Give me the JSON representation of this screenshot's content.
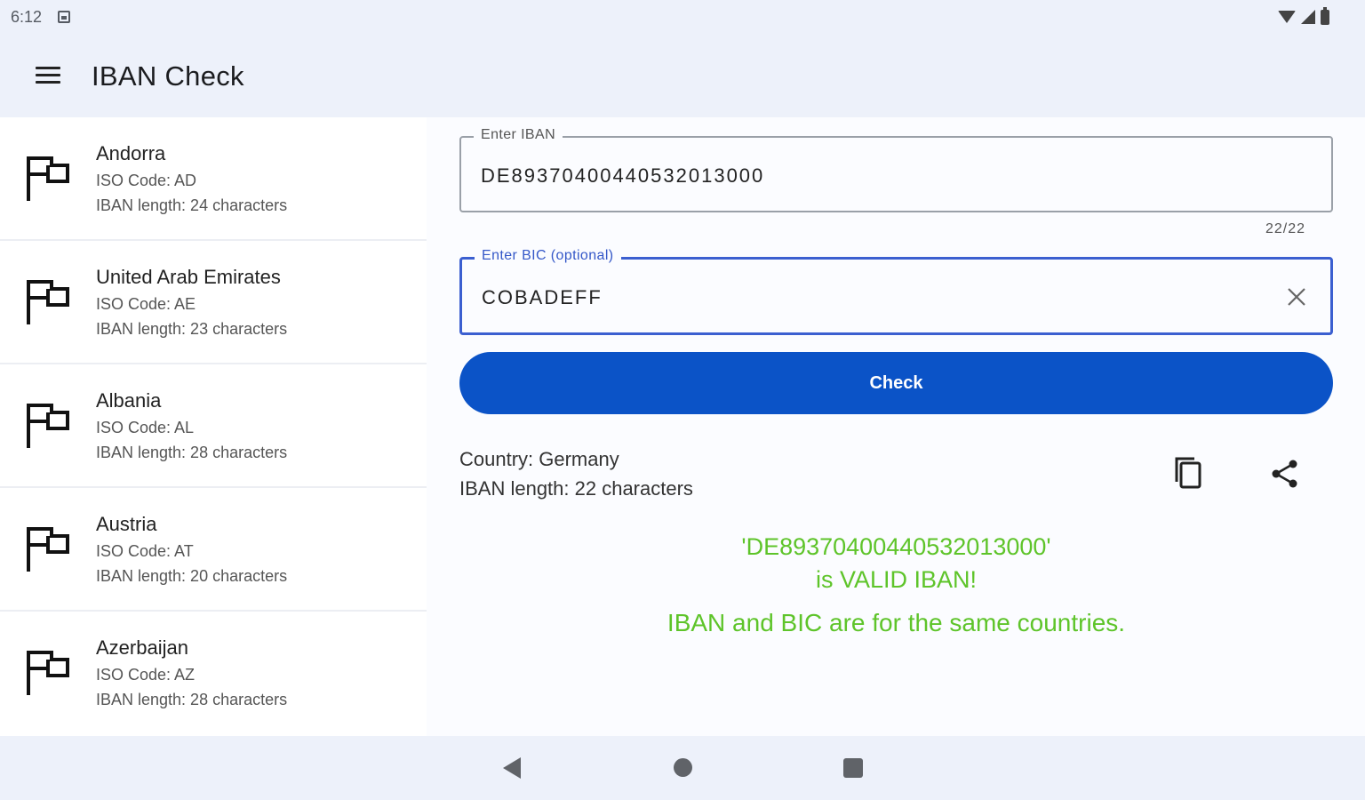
{
  "status_bar": {
    "time": "6:12"
  },
  "app_bar": {
    "title": "IBAN Check"
  },
  "countries": [
    {
      "name": "Andorra",
      "iso": "ISO Code: AD",
      "length": "IBAN length: 24 characters"
    },
    {
      "name": "United Arab Emirates",
      "iso": "ISO Code: AE",
      "length": "IBAN length: 23 characters"
    },
    {
      "name": "Albania",
      "iso": "ISO Code: AL",
      "length": "IBAN length: 28 characters"
    },
    {
      "name": "Austria",
      "iso": "ISO Code: AT",
      "length": "IBAN length: 20 characters"
    },
    {
      "name": "Azerbaijan",
      "iso": "ISO Code: AZ",
      "length": "IBAN length: 28 characters"
    }
  ],
  "form": {
    "iban_label": "Enter IBAN",
    "iban_value": "DE89370400440532013000",
    "iban_counter": "22/22",
    "bic_label": "Enter BIC (optional)",
    "bic_value": "COBADEFF",
    "check_label": "Check"
  },
  "result": {
    "country": "Country: Germany",
    "length": "IBAN length: 22 characters",
    "valid_line1": "'DE89370400440532013000'",
    "valid_line2": "is VALID IBAN!",
    "valid_line3": "IBAN and BIC are for the same countries."
  },
  "colors": {
    "accent": "#0b53c7",
    "valid": "#5ec42a",
    "focus": "#3b5fd0",
    "bar_bg": "#edf1fa"
  }
}
